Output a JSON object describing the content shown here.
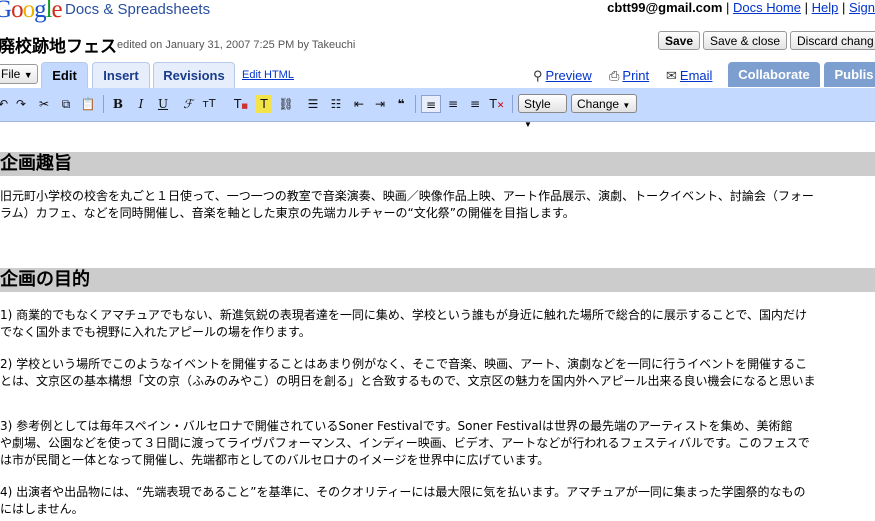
{
  "brand": {
    "logo": "Google",
    "product": "Docs & Spreadsheets"
  },
  "user": {
    "email": "cbtt99@gmail.com",
    "links": [
      "Docs Home",
      "Help",
      "Sign"
    ]
  },
  "document": {
    "title": "廃校跡地フェス",
    "edited": "edited on January 31, 2007 7:25 PM by Takeuchi"
  },
  "buttons": {
    "save": "Save",
    "save_close": "Save & close",
    "discard": "Discard chang"
  },
  "tabs": {
    "file": "File",
    "edit": "Edit",
    "insert": "Insert",
    "revisions": "Revisions",
    "edit_html": "Edit HTML",
    "preview": "Preview",
    "print": "Print",
    "email": "Email",
    "collaborate": "Collaborate",
    "publish": "Publis"
  },
  "toolbar": {
    "style": "Style",
    "change": "Change"
  },
  "content": {
    "sections": [
      {
        "heading": "企画趣旨",
        "paragraphs": [
          [
            "旧元町小学校の校舎を丸ごと１日使って、一つ一つの教室で音楽演奏、映画／映像作品上映、アート作品展示、演劇、トークイベント、討論会（フォー",
            "ラム）カフェ、などを同時開催し、音楽を軸とした東京の先端カルチャーの“文化祭”の開催を目指します。"
          ]
        ]
      },
      {
        "heading": "企画の目的",
        "paragraphs": [
          [
            "1) 商業的でもなくアマチュアでもない、新進気鋭の表現者達を一同に集め、学校という誰もが身近に触れた場所で総合的に展示することで、国内だけ",
            "でなく国外までも視野に入れたアピールの場を作ります。"
          ],
          [
            "2) 学校という場所でこのようなイベントを開催することはあまり例がなく、そこで音楽、映画、アート、演劇などを一同に行うイベントを開催するこ",
            "とは、文京区の基本構想「文の京（ふみのみやこ）の明日を創る」と合致するもので、文京区の魅力を国内外へアピール出来る良い機会になると思いま"
          ],
          [
            "3) 参考例としては毎年スペイン・バルセロナで開催されているSoner Festivalです。Soner Festivalは世界の最先端のアーティストを集め、美術館",
            "や劇場、公園などを使って３日間に渡ってライヴパフォーマンス、インディー映画、ビデオ、アートなどが行われるフェスティバルです。このフェスで",
            "は市が民間と一体となって開催し、先端都市としてのバルセロナのイメージを世界中に広げています。"
          ],
          [
            "4) 出演者や出品物には、“先端表現であること”を基準に、そのクオリティーには最大限に気を払います。アマチュアが一同に集まった学園祭的なもの",
            "にはしません。"
          ]
        ]
      }
    ]
  }
}
